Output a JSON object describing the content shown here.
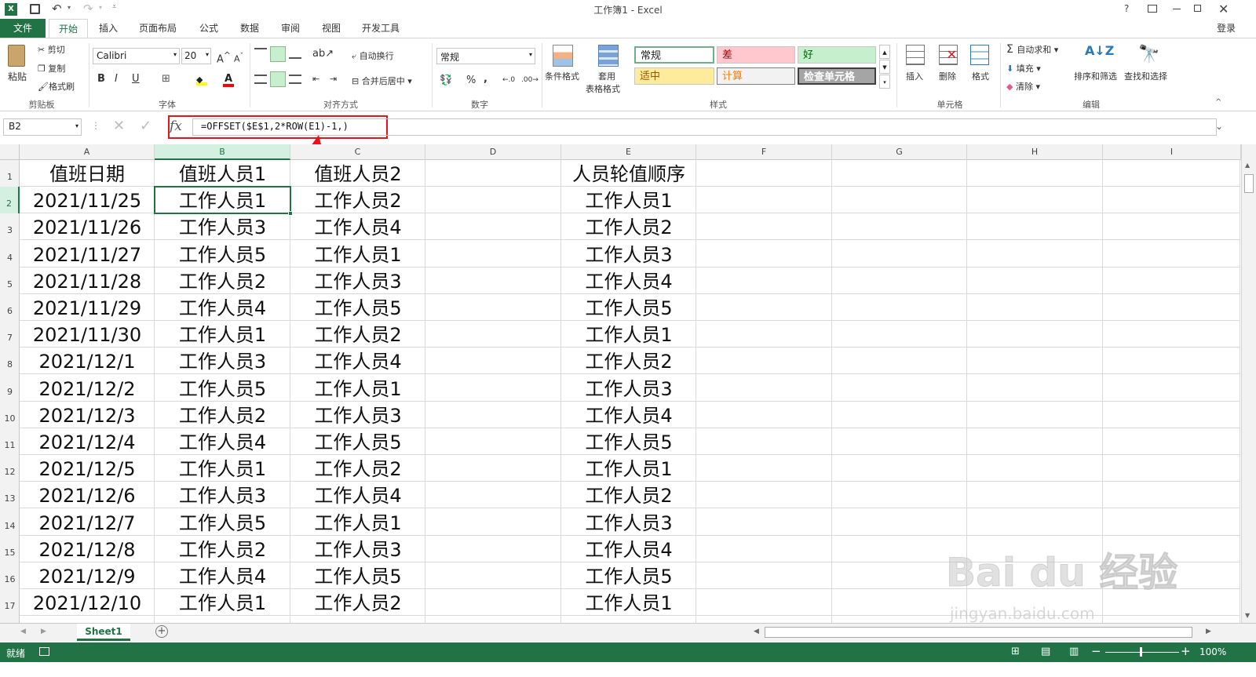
{
  "window": {
    "title": "工作簿1 - Excel",
    "help": "?",
    "signin": "登录"
  },
  "ribbon_tabs": [
    "文件",
    "开始",
    "插入",
    "页面布局",
    "公式",
    "数据",
    "审阅",
    "视图",
    "开发工具"
  ],
  "clipboard": {
    "paste": "粘贴",
    "cut": "剪切",
    "copy": "复制",
    "format_painter": "格式刷",
    "label": "剪贴板"
  },
  "font": {
    "name": "Calibri",
    "size": "20",
    "bold": "B",
    "italic": "I",
    "underline": "U",
    "label": "字体"
  },
  "alignment": {
    "wrap": "自动换行",
    "merge": "合并后居中",
    "label": "对齐方式"
  },
  "number": {
    "format": "常规",
    "percent": "%",
    "comma": ",",
    "label": "数字"
  },
  "styles": {
    "conditional": "条件格式",
    "table_format_1": "套用",
    "table_format_2": "表格格式",
    "cells": [
      {
        "label": "常规",
        "bg": "#ffffff",
        "fg": "#000000"
      },
      {
        "label": "差",
        "bg": "#ffc7ce",
        "fg": "#9c0006"
      },
      {
        "label": "好",
        "bg": "#c6efce",
        "fg": "#006100"
      },
      {
        "label": "适中",
        "bg": "#ffeb9c",
        "fg": "#9c5700"
      },
      {
        "label": "计算",
        "bg": "#f2f2f2",
        "fg": "#fa7d00"
      },
      {
        "label": "检查单元格",
        "bg": "#a5a5a5",
        "fg": "#ffffff"
      }
    ],
    "label": "样式"
  },
  "cells_group": {
    "insert": "插入",
    "delete": "删除",
    "format": "格式",
    "label": "单元格"
  },
  "editing": {
    "autosum": "自动求和",
    "fill": "填充",
    "clear": "清除",
    "sort": "排序和筛选",
    "find": "查找和选择",
    "label": "编辑"
  },
  "formula_bar": {
    "name_box": "B2",
    "fx": "fx",
    "formula": "=OFFSET($E$1,2*ROW(E1)-1,)"
  },
  "columns": [
    "A",
    "B",
    "C",
    "D",
    "E",
    "F",
    "G",
    "H",
    "I"
  ],
  "rows": [
    {
      "n": "1",
      "a": "值班日期",
      "b": "值班人员1",
      "c": "值班人员2",
      "e": "人员轮值顺序"
    },
    {
      "n": "2",
      "a": "2021/11/25",
      "b": "工作人员1",
      "c": "工作人员2",
      "e": "工作人员1"
    },
    {
      "n": "3",
      "a": "2021/11/26",
      "b": "工作人员3",
      "c": "工作人员4",
      "e": "工作人员2"
    },
    {
      "n": "4",
      "a": "2021/11/27",
      "b": "工作人员5",
      "c": "工作人员1",
      "e": "工作人员3"
    },
    {
      "n": "5",
      "a": "2021/11/28",
      "b": "工作人员2",
      "c": "工作人员3",
      "e": "工作人员4"
    },
    {
      "n": "6",
      "a": "2021/11/29",
      "b": "工作人员4",
      "c": "工作人员5",
      "e": "工作人员5"
    },
    {
      "n": "7",
      "a": "2021/11/30",
      "b": "工作人员1",
      "c": "工作人员2",
      "e": "工作人员1"
    },
    {
      "n": "8",
      "a": "2021/12/1",
      "b": "工作人员3",
      "c": "工作人员4",
      "e": "工作人员2"
    },
    {
      "n": "9",
      "a": "2021/12/2",
      "b": "工作人员5",
      "c": "工作人员1",
      "e": "工作人员3"
    },
    {
      "n": "10",
      "a": "2021/12/3",
      "b": "工作人员2",
      "c": "工作人员3",
      "e": "工作人员4"
    },
    {
      "n": "11",
      "a": "2021/12/4",
      "b": "工作人员4",
      "c": "工作人员5",
      "e": "工作人员5"
    },
    {
      "n": "12",
      "a": "2021/12/5",
      "b": "工作人员1",
      "c": "工作人员2",
      "e": "工作人员1"
    },
    {
      "n": "13",
      "a": "2021/12/6",
      "b": "工作人员3",
      "c": "工作人员4",
      "e": "工作人员2"
    },
    {
      "n": "14",
      "a": "2021/12/7",
      "b": "工作人员5",
      "c": "工作人员1",
      "e": "工作人员3"
    },
    {
      "n": "15",
      "a": "2021/12/8",
      "b": "工作人员2",
      "c": "工作人员3",
      "e": "工作人员4"
    },
    {
      "n": "16",
      "a": "2021/12/9",
      "b": "工作人员4",
      "c": "工作人员5",
      "e": "工作人员5"
    },
    {
      "n": "17",
      "a": "2021/12/10",
      "b": "工作人员1",
      "c": "工作人员2",
      "e": "工作人员1"
    }
  ],
  "sheet_tab": "Sheet1",
  "status": {
    "ready": "就绪",
    "zoom": "100%"
  },
  "watermark": {
    "brand": "Bai du 经验",
    "url": "jingyan.baidu.com"
  },
  "colors": {
    "excel_green": "#217346",
    "accent_red": "#e8141b",
    "selection": "#217346"
  }
}
